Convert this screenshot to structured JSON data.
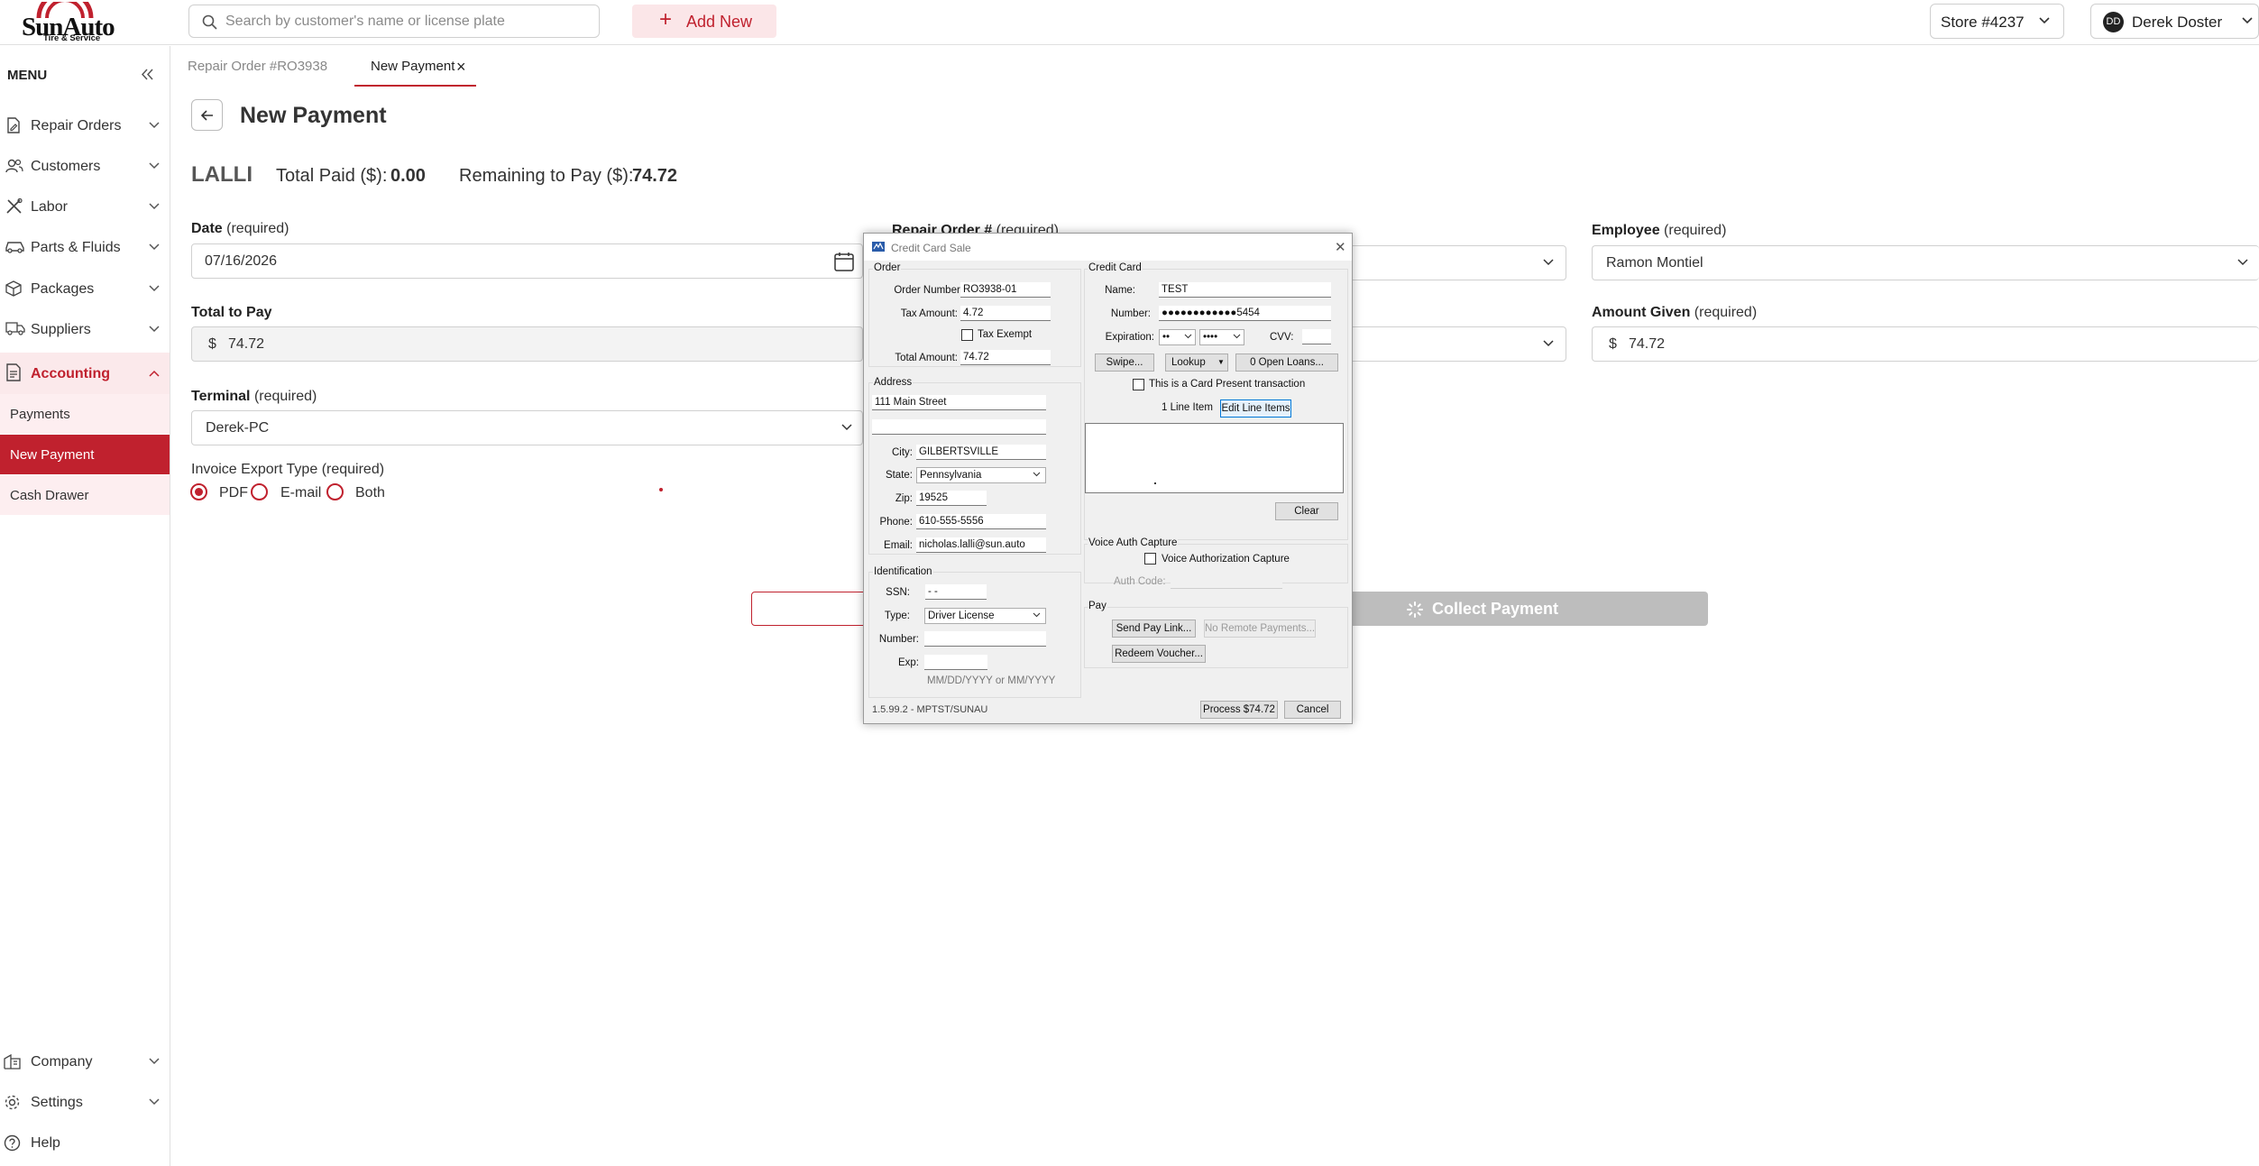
{
  "brand": {
    "name": "SunAuto",
    "tagline": "Tire & Service"
  },
  "header": {
    "search_placeholder": "Search by customer's name or license plate",
    "add_new_label": "Add New",
    "store_label": "Store #4237",
    "user_initials": "DD",
    "user_name": "Derek Doster"
  },
  "sidebar": {
    "menu_label": "MENU",
    "items": [
      {
        "label": "Repair Orders",
        "icon": "file-edit-icon"
      },
      {
        "label": "Customers",
        "icon": "users-icon"
      },
      {
        "label": "Labor",
        "icon": "tools-icon"
      },
      {
        "label": "Parts & Fluids",
        "icon": "car-icon"
      },
      {
        "label": "Packages",
        "icon": "box-icon"
      },
      {
        "label": "Suppliers",
        "icon": "truck-icon"
      },
      {
        "label": "Accounting",
        "icon": "ledger-icon"
      }
    ],
    "accounting_sub": [
      "Payments",
      "New Payment",
      "Cash Drawer"
    ],
    "bottom": [
      {
        "label": "Company",
        "icon": "building-icon"
      },
      {
        "label": "Settings",
        "icon": "gear-icon"
      },
      {
        "label": "Help",
        "icon": "help-icon"
      }
    ]
  },
  "tabs": [
    {
      "label": "Repair Order #RO3938"
    },
    {
      "label": "New Payment"
    }
  ],
  "page": {
    "title": "New Payment",
    "customer": "LALLI",
    "total_paid_label": "Total Paid ($):",
    "total_paid_value": "0.00",
    "remaining_label": "Remaining to Pay ($):",
    "remaining_value": "74.72"
  },
  "form": {
    "date_label": "Date",
    "date_value": "07/16/2026",
    "repair_order_label": "Repair Order #",
    "employee_label": "Employee",
    "employee_value": "Ramon Montiel",
    "total_label": "Total to Pay",
    "currency": "$",
    "total_value": "74.72",
    "amount_given_label": "Amount Given",
    "amount_given_value": "74.72",
    "terminal_label": "Terminal",
    "terminal_value": "Derek-PC",
    "export_label": "Invoice Export Type",
    "required": "(required)",
    "export_options": [
      "PDF",
      "E-mail",
      "Both"
    ],
    "export_selected": "PDF",
    "collect_label": "Collect Payment"
  },
  "dialog": {
    "title": "Credit Card Sale",
    "order": {
      "group": "Order",
      "order_number_label": "Order Number:",
      "order_number": "RO3938-01",
      "tax_amount_label": "Tax Amount:",
      "tax_amount": "4.72",
      "tax_exempt_label": "Tax Exempt",
      "total_amount_label": "Total Amount:",
      "total_amount": "74.72"
    },
    "address": {
      "group": "Address",
      "line1": "111 Main Street",
      "line2": "",
      "city_label": "City:",
      "city": "GILBERTSVILLE",
      "state_label": "State:",
      "state": "Pennsylvania",
      "zip_label": "Zip:",
      "zip": "19525",
      "phone_label": "Phone:",
      "phone": "610-555-5556",
      "email_label": "Email:",
      "email": "nicholas.lalli@sun.auto"
    },
    "identification": {
      "group": "Identification",
      "ssn_label": "SSN:",
      "ssn": " -  -",
      "type_label": "Type:",
      "type": "Driver License",
      "number_label": "Number:",
      "number": "",
      "exp_label": "Exp:",
      "exp": "",
      "exp_hint": "MM/DD/YYYY or MM/YYYY"
    },
    "credit_card": {
      "group": "Credit Card",
      "name_label": "Name:",
      "name": "TEST",
      "number_label": "Number:",
      "number": "●●●●●●●●●●●●5454",
      "expiration_label": "Expiration:",
      "exp_month": "••",
      "exp_year": "••••",
      "cvv_label": "CVV:",
      "swipe_label": "Swipe...",
      "lookup_label": "Lookup",
      "open_loans_label": "0 Open Loans...",
      "card_present_label": "This is a Card Present transaction",
      "line_item_count": "1 Line Item",
      "edit_line_items_label": "Edit Line Items",
      "clear_label": "Clear"
    },
    "voice": {
      "group": "Voice Auth Capture",
      "checkbox_label": "Voice Authorization Capture",
      "auth_code_label": "Auth Code:"
    },
    "pay": {
      "group": "Pay",
      "send_pay_link_label": "Send Pay Link...",
      "no_remote_label": "No Remote Payments...",
      "redeem_label": "Redeem Voucher..."
    },
    "version": "1.5.99.2 - MPTST/SUNAU",
    "process_label": "Process $74.72",
    "cancel_label": "Cancel"
  },
  "colors": {
    "accent": "#c0212e",
    "accent_light": "#fbe9eb",
    "disabled": "#bdbdbd"
  }
}
